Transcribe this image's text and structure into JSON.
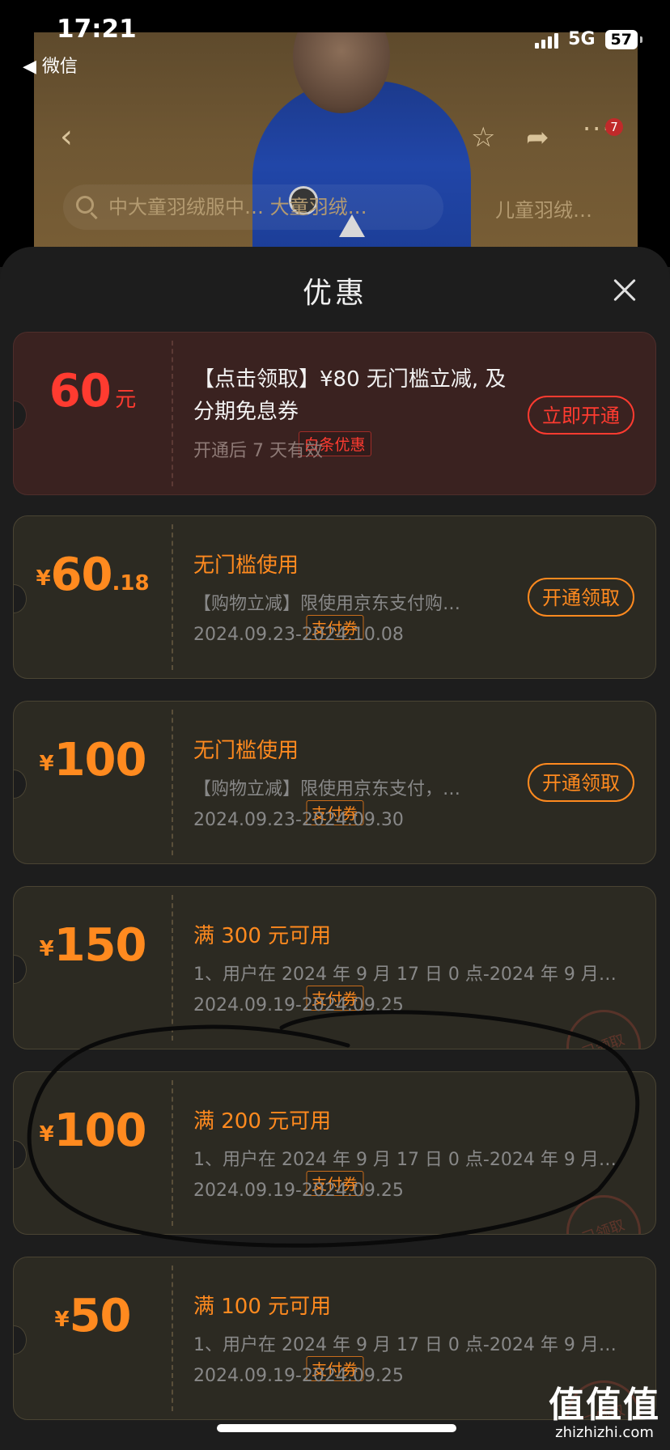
{
  "status_bar": {
    "time": "17:21",
    "back_app": "◀ 微信",
    "network": "5G",
    "battery": "57"
  },
  "background_page": {
    "search_text": "中大童羽绒服中… 大童羽绒…",
    "related_text": "儿童羽绒…",
    "cart_badge": "7"
  },
  "sheet": {
    "title": "优惠",
    "coupons": [
      {
        "amount": "60",
        "unit": "元",
        "tag": "白条优惠",
        "title": "【点击领取】¥80 无门槛立减, 及分期免息券",
        "sub": "开通后 7 天有效",
        "button": "立即开通"
      },
      {
        "currency": "¥",
        "amount": "60",
        "decimal": ".18",
        "tag": "支付券",
        "title": "无门槛使用",
        "desc": "【购物立减】限使用京东支付购…",
        "date": "2024.09.23-2024.10.08",
        "button": "开通领取"
      },
      {
        "currency": "¥",
        "amount": "100",
        "tag": "支付券",
        "title": "无门槛使用",
        "desc": "【购物立减】限使用京东支付，…",
        "date": "2024.09.23-2024.09.30",
        "button": "开通领取"
      },
      {
        "currency": "¥",
        "amount": "150",
        "tag": "支付券",
        "title": "满 300 元可用",
        "desc": "1、用户在 2024 年 9 月 17 日 0 点-2024 年 9 月…",
        "date": "2024.09.19-2024.09.25",
        "stamp": "已领取"
      },
      {
        "currency": "¥",
        "amount": "100",
        "tag": "支付券",
        "title": "满 200 元可用",
        "desc": "1、用户在 2024 年 9 月 17 日 0 点-2024 年 9 月…",
        "date": "2024.09.19-2024.09.25",
        "stamp": "已领取"
      },
      {
        "currency": "¥",
        "amount": "50",
        "tag": "支付券",
        "title": "满 100 元可用",
        "desc": "1、用户在 2024 年 9 月 17 日 0 点-2024 年 9 月…",
        "date": "2024.09.19-2024.09.25",
        "stamp": "已领取"
      }
    ]
  },
  "watermark": {
    "main": "值值值",
    "sub": "zhizhizhi.com"
  },
  "colors": {
    "accent": "#ff8a1f",
    "red": "#ff3b30",
    "sheet_bg": "#1d1d1d",
    "coupon_bg": "#2c2a22"
  }
}
